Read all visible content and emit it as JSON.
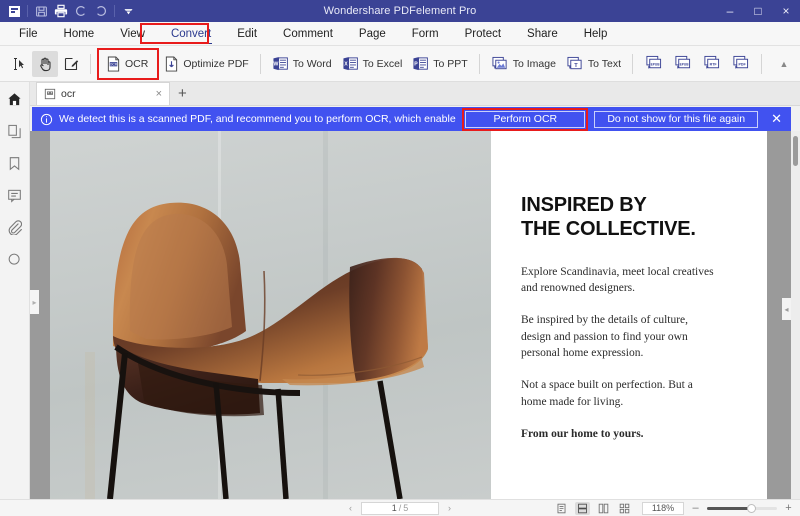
{
  "window": {
    "title": "Wondershare PDFelement Pro",
    "quick_access": [
      "app-logo",
      "save-icon",
      "print-icon",
      "undo-icon",
      "redo-icon",
      "customize-dropdown-icon"
    ],
    "controls": {
      "minimize": "–",
      "maximize": "□",
      "close": "×"
    },
    "accent": "#3b4395",
    "highlight_color": "#e81b1b"
  },
  "menubar": {
    "items": [
      {
        "label": "File",
        "active": false
      },
      {
        "label": "Home",
        "active": false
      },
      {
        "label": "View",
        "active": false
      },
      {
        "label": "Convert",
        "active": true
      },
      {
        "label": "Edit",
        "active": false
      },
      {
        "label": "Comment",
        "active": false
      },
      {
        "label": "Page",
        "active": false
      },
      {
        "label": "Form",
        "active": false
      },
      {
        "label": "Protect",
        "active": false
      },
      {
        "label": "Share",
        "active": false
      },
      {
        "label": "Help",
        "active": false
      }
    ]
  },
  "ribbon": {
    "mode_tools": [
      {
        "name": "select-text-tool",
        "selected": false
      },
      {
        "name": "hand-tool",
        "selected": true
      },
      {
        "name": "edit-tool",
        "selected": false
      }
    ],
    "tools": [
      {
        "label": "OCR",
        "icon": "ocr-icon",
        "highlighted": true
      },
      {
        "label": "Optimize PDF",
        "icon": "optimize-pdf-icon",
        "highlighted": false
      },
      {
        "label": "To Word",
        "icon": "to-word-icon",
        "highlighted": false
      },
      {
        "label": "To Excel",
        "icon": "to-excel-icon",
        "highlighted": false
      },
      {
        "label": "To PPT",
        "icon": "to-ppt-icon",
        "highlighted": false
      },
      {
        "label": "To Image",
        "icon": "to-image-icon",
        "highlighted": false
      },
      {
        "label": "To Text",
        "icon": "to-text-icon",
        "highlighted": false
      }
    ],
    "format_icons": [
      {
        "name": "to-epub-icon",
        "label": "EPUB"
      },
      {
        "name": "to-epub-alt-icon",
        "label": "EPUB"
      },
      {
        "name": "to-rtf-icon",
        "label": "RTF"
      },
      {
        "name": "to-pdfa-icon",
        "label": "PDF"
      }
    ],
    "collapse_glyph": "▲"
  },
  "sidebar": {
    "items": [
      {
        "name": "home-icon",
        "selected": true
      },
      {
        "name": "thumbnails-icon",
        "selected": false
      },
      {
        "name": "bookmark-icon",
        "selected": false
      },
      {
        "name": "comments-icon",
        "selected": false
      },
      {
        "name": "attachments-icon",
        "selected": false
      },
      {
        "name": "search-icon",
        "selected": false
      }
    ]
  },
  "tabstrip": {
    "tabs": [
      {
        "label": "ocr",
        "close": "×",
        "active": true
      }
    ],
    "add_label": "+"
  },
  "notification": {
    "icon": "info-icon",
    "message": "We detect this is a scanned PDF, and recommend you to perform OCR, which enables you to ...",
    "primary_button": "Perform OCR",
    "secondary_button": "Do not show for this file again",
    "close": "✕",
    "background": "#4152f0",
    "primary_highlighted": true
  },
  "document": {
    "headline_line1": "INSPIRED BY",
    "headline_line2": "THE COLLECTIVE.",
    "paragraphs": [
      {
        "text": "Explore Scandinavia, meet local creatives and renowned designers.",
        "bold": false
      },
      {
        "text": "Be inspired by the details of culture, design and passion to find your own personal home expression.",
        "bold": false
      },
      {
        "text": "Not a space built on perfection. But a home made for living.",
        "bold": false
      },
      {
        "text": "From our home to yours.",
        "bold": true
      }
    ],
    "photo_alt": "leather-armchair-photo"
  },
  "statusbar": {
    "prev_glyph": "‹",
    "next_glyph": "›",
    "current_page": "1",
    "page_separator": "/",
    "total_pages": "5",
    "view_modes": [
      {
        "name": "single-page-view-icon",
        "selected": false
      },
      {
        "name": "continuous-scroll-view-icon",
        "selected": true
      },
      {
        "name": "facing-page-view-icon",
        "selected": false
      },
      {
        "name": "grid-view-icon",
        "selected": false
      }
    ],
    "zoom_level": "118%",
    "zoom_out": "–",
    "zoom_in": "+"
  }
}
